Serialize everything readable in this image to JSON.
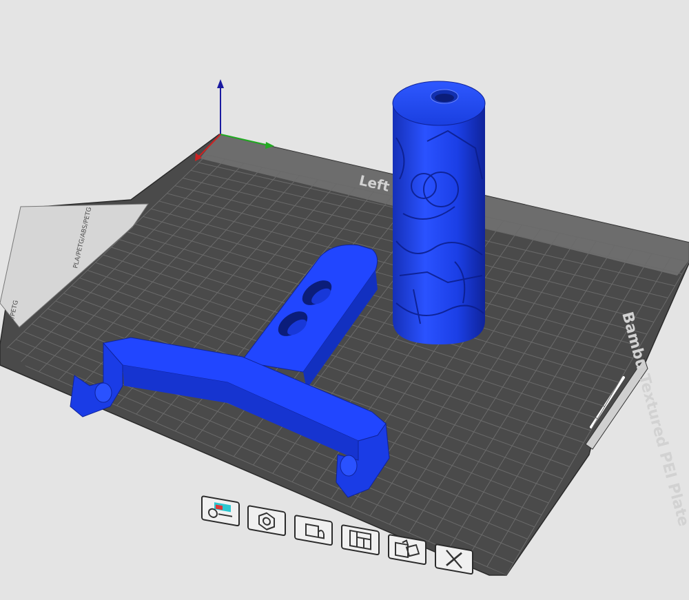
{
  "bed": {
    "plate_name": "Bambu Textured PEI Plate",
    "excluded_area_label": "Left ... area",
    "side_label_top": "PLA/PETG/ABS/PETG",
    "side_label_bottom": "ABS/PETG"
  },
  "colors": {
    "background": "#e4e4e4",
    "plate": "#4a4a4a",
    "grid": "#6a6a6a",
    "model": "#1a3fe0",
    "axis_x": "#cc2222",
    "axis_y": "#22aa22",
    "axis_z": "#1a1aa0"
  },
  "toolbar": {
    "tools": [
      {
        "name": "plate-settings",
        "icon": "plate-settings-icon"
      },
      {
        "name": "arrange",
        "icon": "hexagon-arrange-icon"
      },
      {
        "name": "lock",
        "icon": "lock-icon"
      },
      {
        "name": "layout",
        "icon": "layout-icon"
      },
      {
        "name": "auto-orient",
        "icon": "auto-orient-icon"
      },
      {
        "name": "remove",
        "icon": "close-icon"
      }
    ]
  }
}
